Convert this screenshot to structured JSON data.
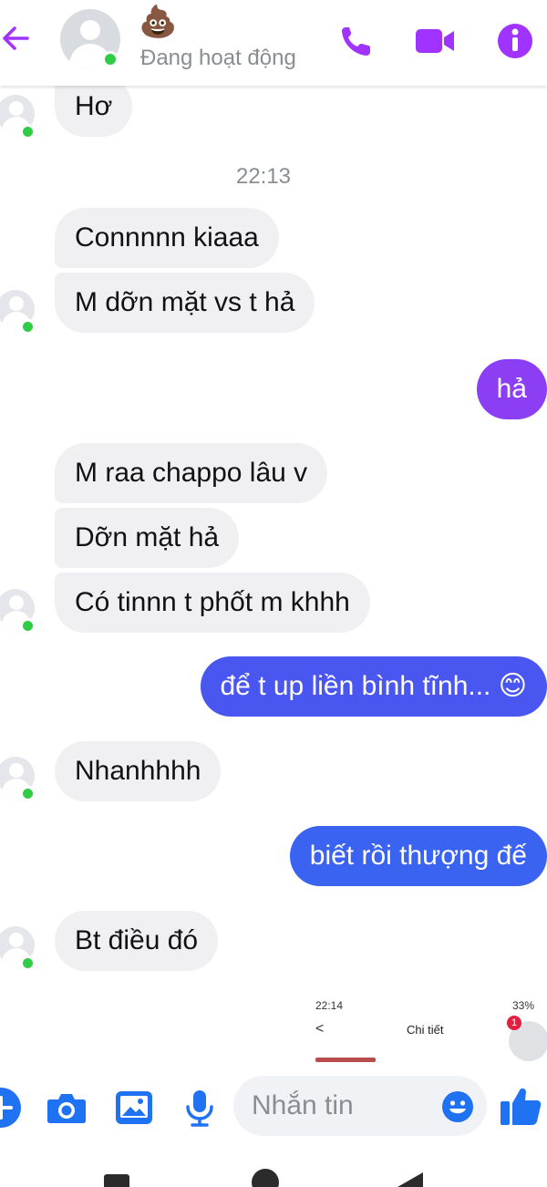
{
  "header": {
    "contact_name": "💩",
    "status": "Đang hoạt động",
    "icons": [
      "back-arrow-icon",
      "call-icon",
      "video-icon",
      "info-icon"
    ]
  },
  "chat": {
    "messages": [
      {
        "from": "them",
        "text": "Hơ"
      },
      {
        "type": "time",
        "text": "22:13"
      },
      {
        "from": "them",
        "text": "Connnnn kiaaa"
      },
      {
        "from": "them",
        "text": "M dỡn mặt vs t hả"
      },
      {
        "from": "me",
        "text": "hả"
      },
      {
        "from": "them",
        "text": "M raa chappo lâu v"
      },
      {
        "from": "them",
        "text": "Dỡn mặt hả"
      },
      {
        "from": "them",
        "text": "Có tinnn t phốt m khhh"
      },
      {
        "from": "me",
        "text": "để t up liền bình tĩnh... 😊"
      },
      {
        "from": "them",
        "text": "Nhanhhhh"
      },
      {
        "from": "me",
        "text": "biết rồi thượng đế"
      },
      {
        "from": "them",
        "text": "Bt điều đó"
      }
    ]
  },
  "preview": {
    "time": "22:14",
    "battery": "33%",
    "back": "<",
    "title": "Chi tiết",
    "badge": "1"
  },
  "composer": {
    "placeholder": "Nhắn tin",
    "icons": [
      "plus-icon",
      "camera-icon",
      "image-icon",
      "mic-icon",
      "emoji-icon",
      "like-icon"
    ]
  },
  "colors": {
    "accent": "#a033ff",
    "out_bubble_purple": "#8c3ef5",
    "out_bubble_blue": "#3a63f2",
    "online": "#31cc46"
  }
}
